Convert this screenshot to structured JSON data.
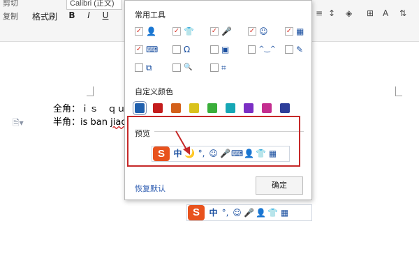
{
  "ribbon": {
    "cut_label": "剪切",
    "copy_label": "复制",
    "format_painter_label": "格式刷",
    "font_name": "Calibri (正文)",
    "format_buttons": [
      "B",
      "I",
      "U"
    ]
  },
  "document": {
    "line1_label": "全角：",
    "line1_value": "ｉｓ　ｑｕａ",
    "line2_label": "半角：",
    "line2_value_plain": "is ban ",
    "line2_value_underlined": "jiao"
  },
  "dialog": {
    "tools_title": "常用工具",
    "tools": [
      {
        "icon": "person-icon",
        "glyph": "👤",
        "checked": true
      },
      {
        "icon": "shirt-icon",
        "glyph": "👕",
        "checked": true
      },
      {
        "icon": "microphone-icon",
        "glyph": "🎤",
        "checked": true
      },
      {
        "icon": "smiley-icon",
        "glyph": "☺",
        "checked": true
      },
      {
        "icon": "grid-icon",
        "glyph": "▦",
        "checked": true
      },
      {
        "icon": "keyboard-icon",
        "glyph": "⌨",
        "checked": true
      },
      {
        "icon": "omega-icon",
        "glyph": "Ω",
        "checked": false
      },
      {
        "icon": "device-icon",
        "glyph": "▣",
        "checked": false
      },
      {
        "icon": "emoticon-icon",
        "glyph": "^‿^",
        "checked": false
      },
      {
        "icon": "pen-icon",
        "glyph": "✎",
        "checked": false
      },
      {
        "icon": "translate-icon",
        "glyph": "⧉",
        "checked": false
      },
      {
        "icon": "search-icon",
        "glyph": "🔍",
        "checked": false
      },
      {
        "icon": "crop-icon",
        "glyph": "⌗",
        "checked": false
      }
    ],
    "color_title": "自定义颜色",
    "colors": [
      "#1f5fad",
      "#c41c1c",
      "#d4601a",
      "#d9c21c",
      "#3aae3a",
      "#16a7b5",
      "#7b2fc4",
      "#c42e8f",
      "#2d3e9a"
    ],
    "selected_color_index": 0,
    "preview_title": "预览",
    "preview_bar": {
      "logo": "S",
      "chinese_mode": "中",
      "items": [
        "🌙",
        "°,",
        "☺",
        "🎤",
        "⌨",
        "👤",
        "👕",
        "▦"
      ]
    },
    "restore_label": "恢复默认",
    "ok_label": "确定"
  },
  "ime_bar": {
    "logo": "S",
    "chinese_mode": "中",
    "items": [
      "°,",
      "☺",
      "🎤",
      "👤",
      "👕",
      "▦"
    ]
  },
  "colors": {
    "accent_red": "#c62828",
    "sogou_orange": "#e8521d",
    "icon_blue": "#1a4fa0"
  }
}
